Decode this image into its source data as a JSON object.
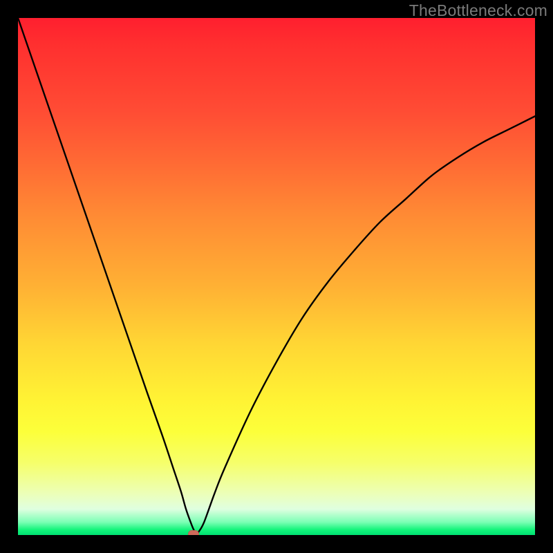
{
  "watermark": "TheBottleneck.com",
  "colors": {
    "frame": "#000000",
    "watermark": "#7a7a7a",
    "curve": "#000000",
    "marker": "#ce6a5b",
    "gradient_stops": [
      "#ff1f2f",
      "#ff4c34",
      "#ff8a34",
      "#ffd634",
      "#fff334",
      "#f6ff6a",
      "#dfffe0",
      "#12f47a",
      "#00e072"
    ]
  },
  "chart_data": {
    "type": "line",
    "title": "",
    "xlabel": "",
    "ylabel": "",
    "xlim": [
      0,
      100
    ],
    "ylim": [
      0,
      100
    ],
    "grid": false,
    "legend": false,
    "series": [
      {
        "name": "bottleneck-curve",
        "x": [
          0,
          5,
          10,
          15,
          20,
          25,
          28,
          30,
          31.5,
          32.5,
          33.5,
          34,
          34.5,
          35,
          36,
          38,
          40,
          45,
          50,
          55,
          60,
          65,
          70,
          75,
          80,
          85,
          90,
          95,
          100
        ],
        "y": [
          100,
          85.5,
          71,
          56.5,
          42,
          27.5,
          19,
          13,
          8.5,
          5,
          2.2,
          1.0,
          0.2,
          0.7,
          2.5,
          8,
          13,
          24,
          33.5,
          42,
          49,
          55,
          60.5,
          65,
          69.5,
          73,
          76,
          78.5,
          81
        ]
      }
    ],
    "annotations": [
      {
        "name": "min-marker",
        "x": 34,
        "y": 0,
        "label": ""
      }
    ],
    "background": {
      "type": "vertical-gradient",
      "description": "Smooth gradient from red (top, high y) through orange/yellow to green (bottom, low y), representing bottleneck severity."
    }
  }
}
